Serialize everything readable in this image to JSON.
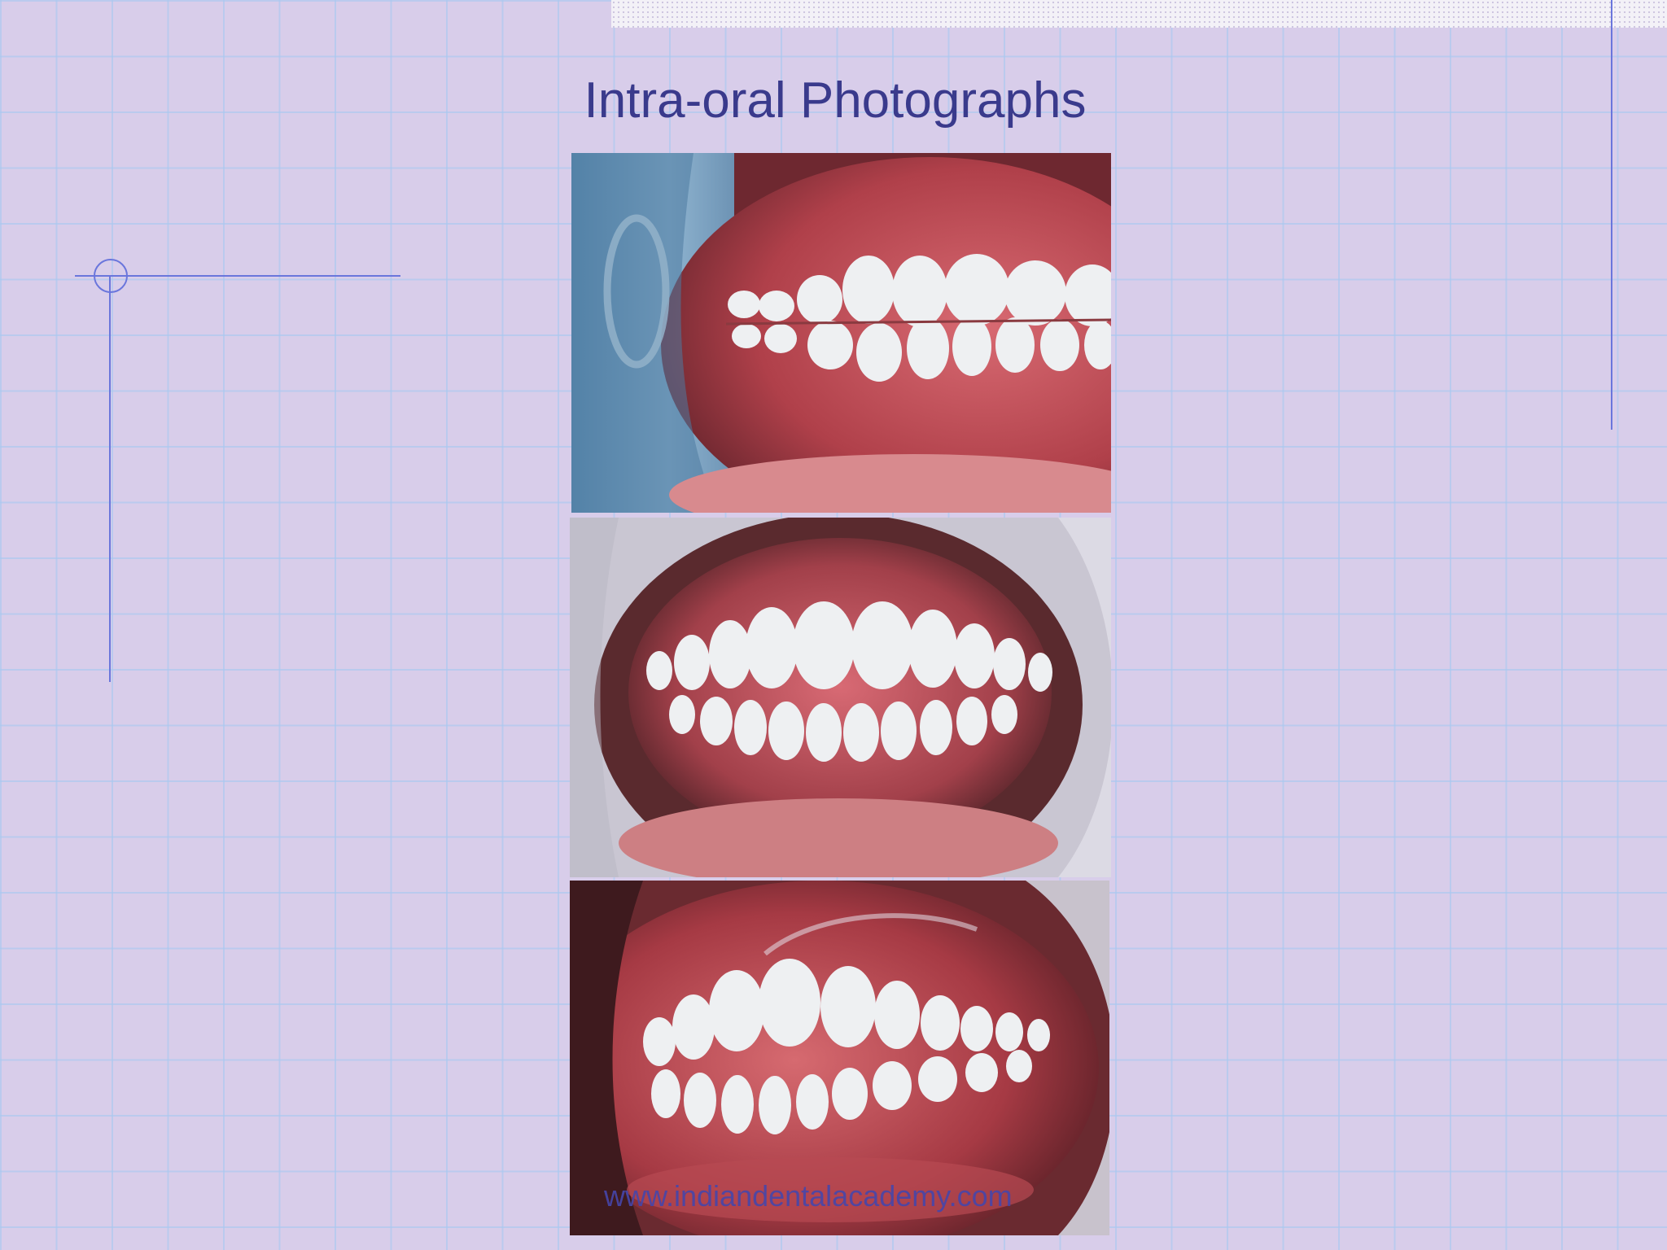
{
  "slide": {
    "title": "Intra-oral Photographs",
    "footer_url": "www.indiandentalacademy.com",
    "colors": {
      "background": "#d8cdea",
      "grid": "#aac8f0",
      "title": "#3a3a8c",
      "deco_lines": "#6a76dc"
    }
  },
  "photos": [
    {
      "view": "right-lateral-occlusion"
    },
    {
      "view": "frontal-occlusion"
    },
    {
      "view": "left-lateral-occlusion"
    }
  ]
}
